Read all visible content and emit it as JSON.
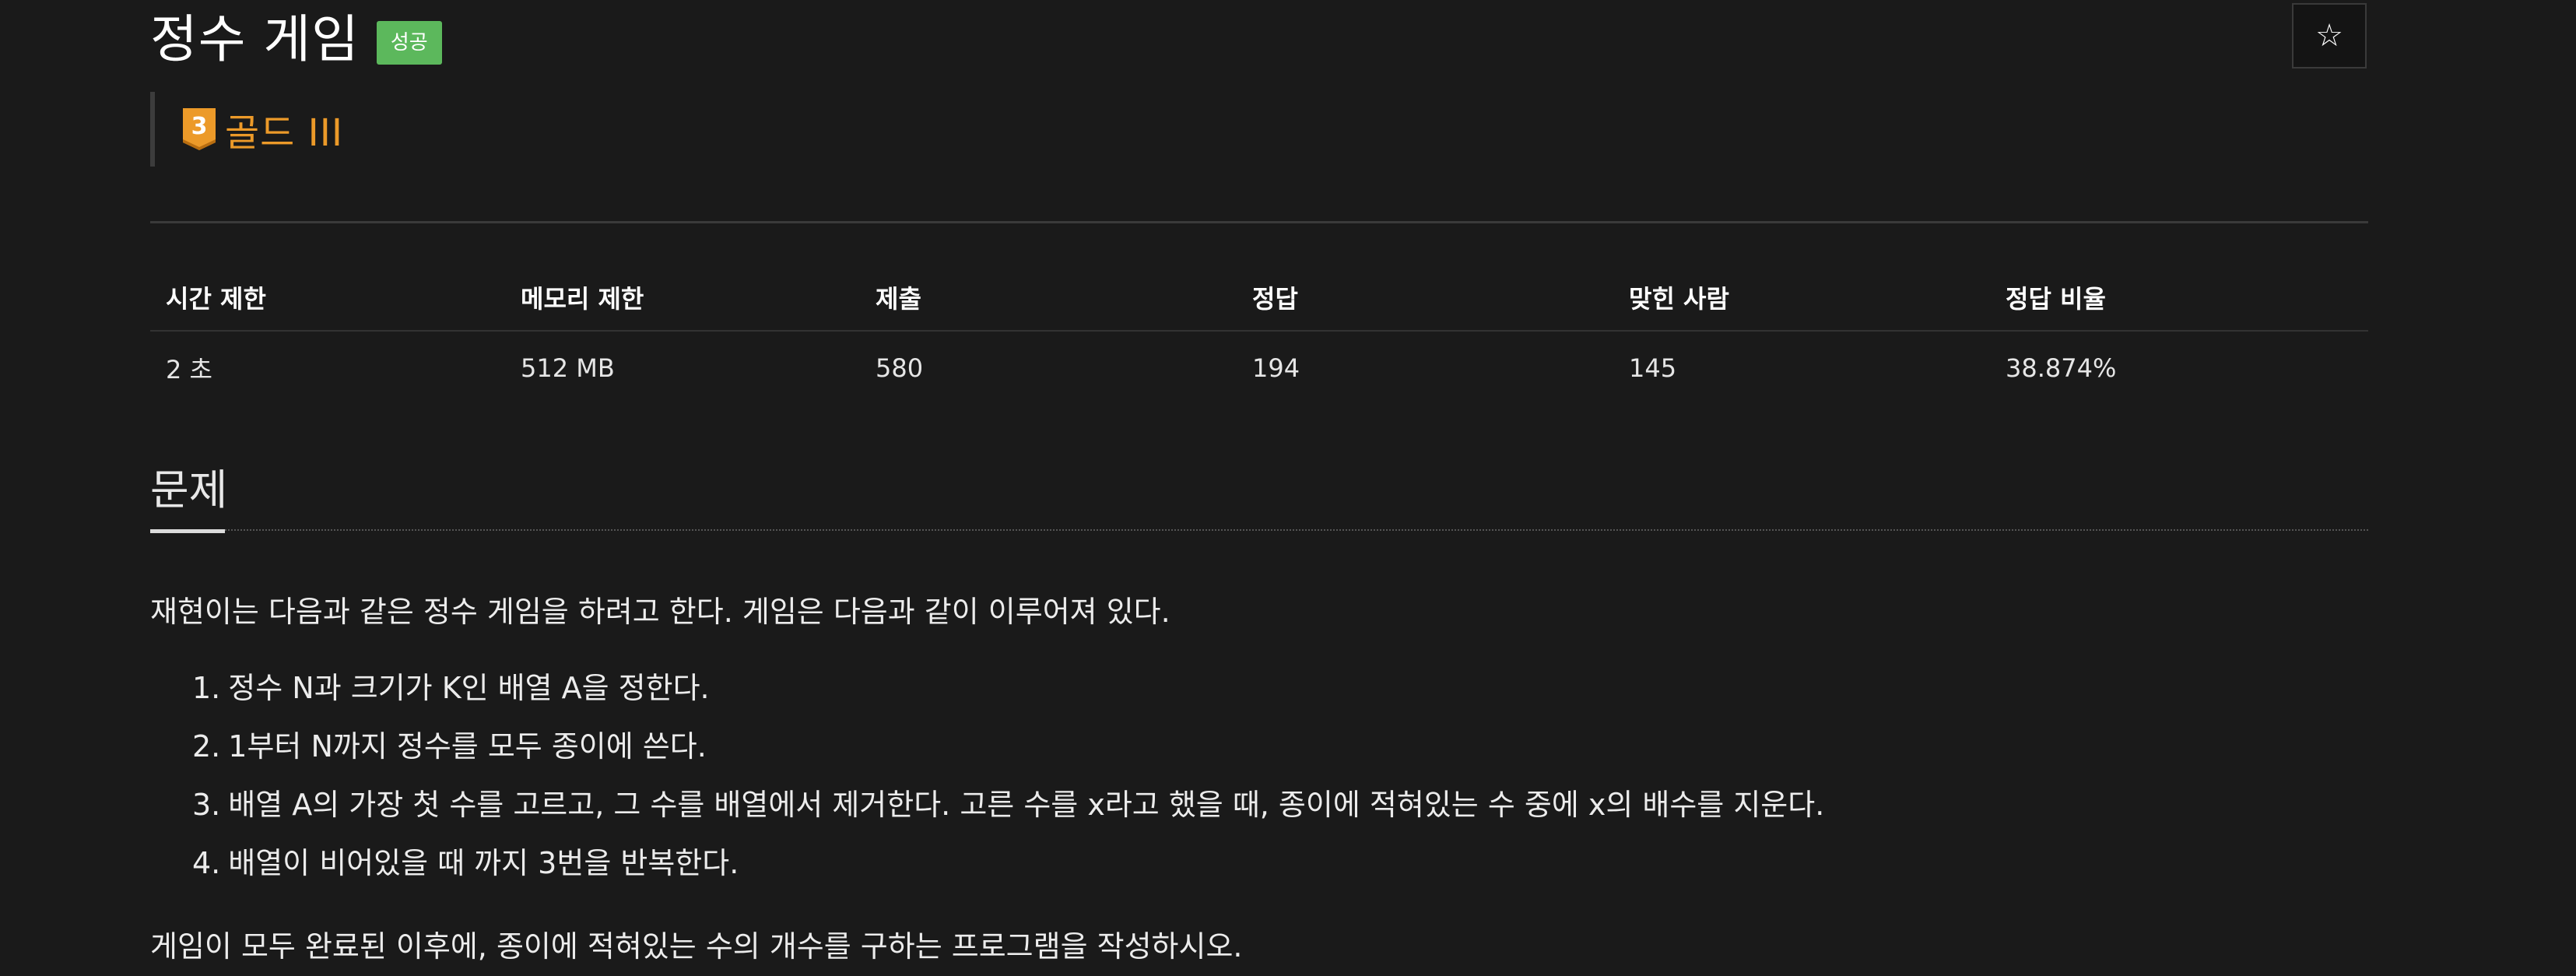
{
  "problem": {
    "title": "정수 게임",
    "status_badge": "성공",
    "tier_number": "3",
    "tier_label": "골드 III",
    "star_icon": "star-outline-icon"
  },
  "stats": {
    "headers": [
      "시간 제한",
      "메모리 제한",
      "제출",
      "정답",
      "맞힌 사람",
      "정답 비율"
    ],
    "values": [
      "2 초",
      "512 MB",
      "580",
      "194",
      "145",
      "38.874%"
    ]
  },
  "section": {
    "title": "문제",
    "intro": "재현이는 다음과 같은 정수 게임을 하려고 한다. 게임은 다음과 같이 이루어져 있다.",
    "steps": [
      {
        "num": "1.",
        "text": "정수 N과 크기가 K인 배열 A을 정한다."
      },
      {
        "num": "2.",
        "text": "1부터 N까지 정수를 모두 종이에 쓴다."
      },
      {
        "num": "3.",
        "text": "배열 A의 가장 첫 수를 고르고, 그 수를 배열에서 제거한다. 고른 수를 x라고 했을 때, 종이에 적혀있는 수 중에 x의 배수를 지운다."
      },
      {
        "num": "4.",
        "text": "배열이 비어있을 때 까지 3번을 반복한다."
      }
    ],
    "outro": "게임이 모두 완료된 이후에, 종이에 적혀있는 수의 개수를 구하는 프로그램을 작성하시오."
  },
  "colors": {
    "background": "#1a1a1a",
    "badge_success": "#5cb85c",
    "tier_gold": "#ec9a29"
  }
}
